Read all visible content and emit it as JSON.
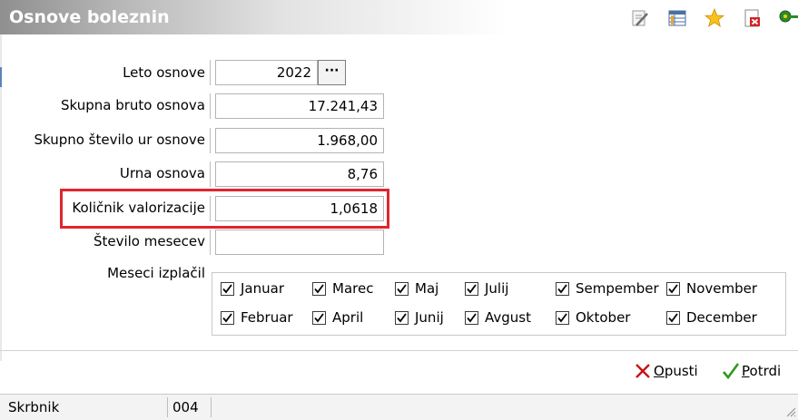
{
  "window": {
    "title": "Osnove boleznin"
  },
  "toolbar": {
    "icons": [
      "edit-icon",
      "table-icon",
      "star-icon",
      "delete-doc-icon",
      "key-icon"
    ]
  },
  "form": {
    "leto_osnove": {
      "label": "Leto osnove",
      "value": "2022",
      "button": "···"
    },
    "skupna_bruto": {
      "label": "Skupna bruto osnova",
      "value": "17.241,43"
    },
    "skupno_ur": {
      "label": "Skupno število ur osnove",
      "value": "1.968,00"
    },
    "urna_osnova": {
      "label": "Urna osnova",
      "value": "8,76"
    },
    "kolicnik": {
      "label": "Količnik valorizacije",
      "value": "1,0618"
    },
    "stevilo_mesecev": {
      "label": "Število mesecev",
      "value": ""
    },
    "meseci_label": "Meseci izplačil"
  },
  "months": [
    {
      "name": "Januar",
      "checked": true
    },
    {
      "name": "Marec",
      "checked": true
    },
    {
      "name": "Maj",
      "checked": true
    },
    {
      "name": "Julij",
      "checked": true
    },
    {
      "name": "Sempember",
      "checked": true
    },
    {
      "name": "November",
      "checked": true
    },
    {
      "name": "Februar",
      "checked": true
    },
    {
      "name": "April",
      "checked": true
    },
    {
      "name": "Junij",
      "checked": true
    },
    {
      "name": "Avgust",
      "checked": true
    },
    {
      "name": "Oktober",
      "checked": true
    },
    {
      "name": "December",
      "checked": true
    }
  ],
  "buttons": {
    "cancel_prefix": "O",
    "cancel_rest": "pusti",
    "confirm_prefix": "P",
    "confirm_rest": "otrdi"
  },
  "status": {
    "user": "Skrbnik",
    "code": "004"
  },
  "colors": {
    "highlight": "#e0262e",
    "cancel": "#cc1111",
    "confirm": "#2e9a1e"
  }
}
